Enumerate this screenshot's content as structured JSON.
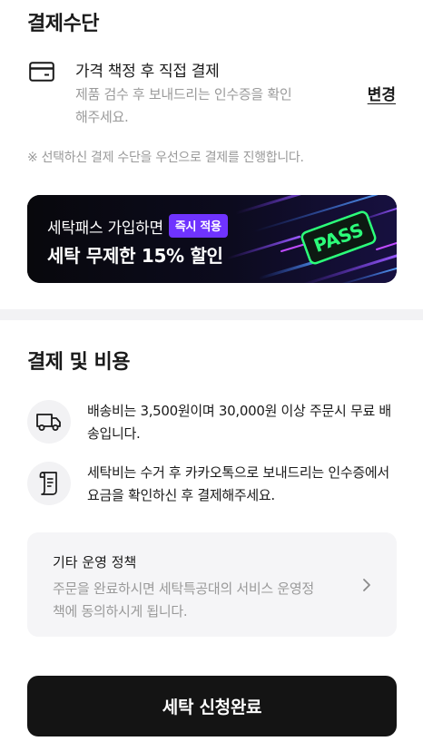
{
  "payment_method": {
    "section_title": "결제수단",
    "method_label": "가격 책정 후 직접 결제",
    "method_desc": "제품 검수 후 보내드리는 인수증을 확인해주세요.",
    "change_label": "변경",
    "card_icon": "card-icon",
    "notice": "※ 선택하신 결제 수단을 우선으로 결제를 진행합니다."
  },
  "banner": {
    "line1": "세탁패스 가입하면",
    "badge": "즉시 적용",
    "line2": "세탁 무제한 15% 할인",
    "logo_text": "PASS",
    "badge_color": "#6f33ff",
    "logo_color": "#2cff7a"
  },
  "fees": {
    "section_title": "결제 및 비용",
    "shipping": {
      "icon": "delivery-truck-icon",
      "text": "배송비는 3,500원이며 30,000원 이상 주문시 무료 배송입니다."
    },
    "receipt": {
      "icon": "receipt-document-icon",
      "text": "세탁비는 수거 후 카카오톡으로 보내드리는 인수증에서 요금을 확인하신 후 결제해주세요."
    }
  },
  "policy": {
    "title": "기타 운영 정책",
    "desc": "주문을 완료하시면 세탁특공대의 서비스 운영정책에 동의하시게 됩니다.",
    "chevron_icon": "chevron-right-icon"
  },
  "submit": {
    "label": "세탁 신청완료"
  }
}
